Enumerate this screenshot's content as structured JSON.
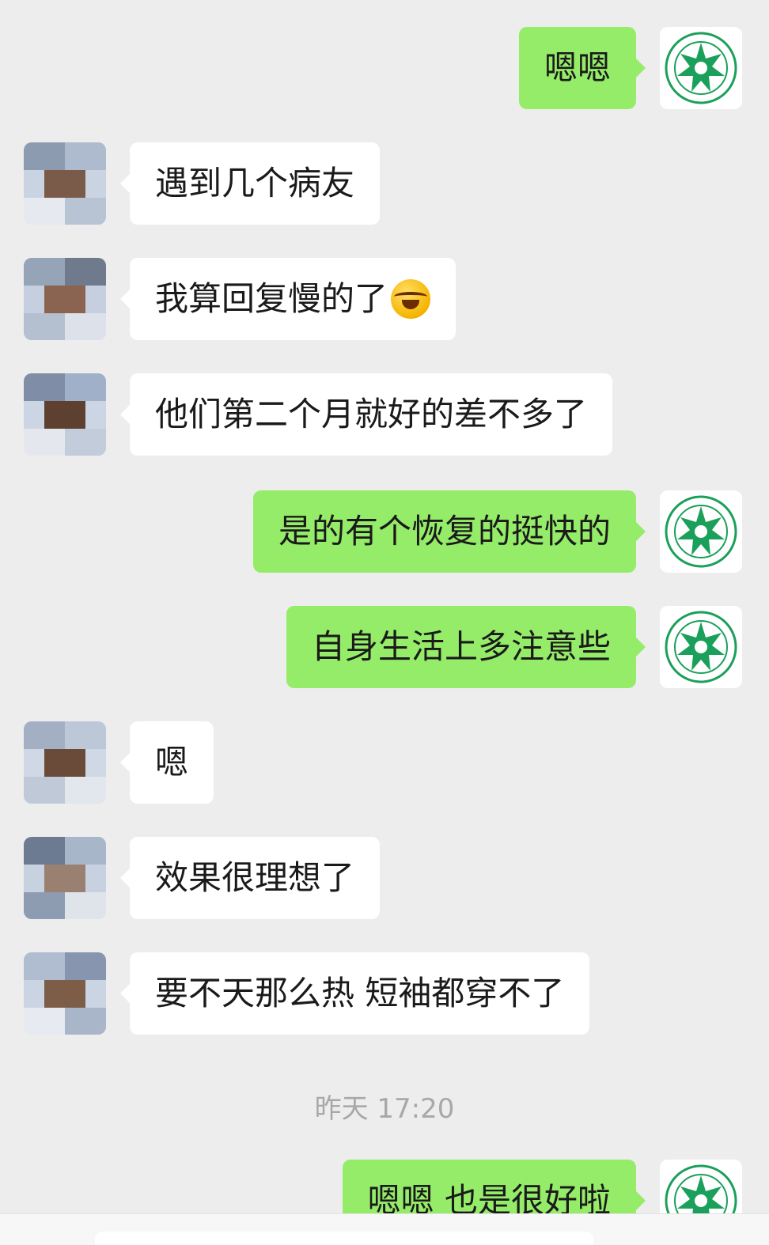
{
  "messages": [
    {
      "side": "out",
      "text": "嗯嗯"
    },
    {
      "side": "in",
      "text": "遇到几个病友"
    },
    {
      "side": "in",
      "text": "我算回复慢的了",
      "emoji": "face-with-tears-of-joy-icon"
    },
    {
      "side": "in",
      "text": "他们第二个月就好的差不多了"
    },
    {
      "side": "out",
      "text": "是的有个恢复的挺快的"
    },
    {
      "side": "out",
      "text": "自身生活上多注意些"
    },
    {
      "side": "in",
      "text": "嗯"
    },
    {
      "side": "in",
      "text": "效果很理想了"
    },
    {
      "side": "in",
      "text": "要不天那么热 短袖都穿不了"
    },
    {
      "side": "out",
      "text": "嗯嗯 也是很好啦"
    }
  ],
  "timestamp": "昨天 17:20",
  "colors": {
    "background": "#ededed",
    "outgoing_bubble": "#95ec69",
    "incoming_bubble": "#ffffff",
    "logo_green": "#1aa05a"
  }
}
